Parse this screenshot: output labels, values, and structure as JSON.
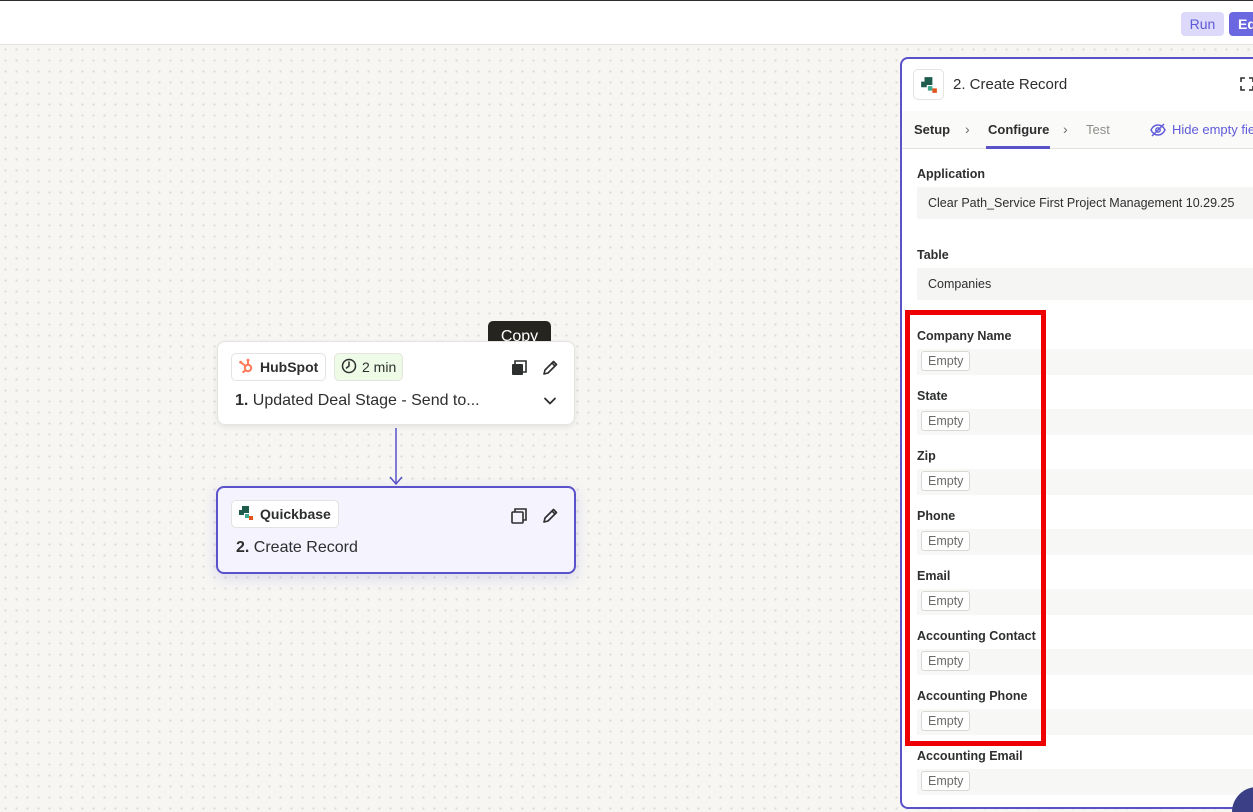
{
  "topbar": {
    "run_label": "Run",
    "edit_label": "Edit"
  },
  "tooltip": {
    "text": "Copy"
  },
  "steps": [
    {
      "app_name": "HubSpot",
      "app_icon": "hubspot-sprocket-icon",
      "duration": "2 min",
      "number": "1.",
      "title": "Updated Deal Stage - Send to...",
      "accent": "#ff7a59"
    },
    {
      "app_name": "Quickbase",
      "app_icon": "quickbase-logo-icon",
      "number": "2.",
      "title": "Create Record",
      "accent": "#5a52c9"
    }
  ],
  "panel": {
    "title": "2. Create Record",
    "tabs": {
      "setup": "Setup",
      "configure": "Configure",
      "test": "Test"
    },
    "hide_empty_label": "Hide empty fie",
    "application": {
      "label": "Application",
      "value": "Clear Path_Service First Project Management 10.29.25"
    },
    "table": {
      "label": "Table",
      "value": "Companies"
    },
    "empty_text": "Empty",
    "fields": [
      {
        "label": "Company Name"
      },
      {
        "label": "State"
      },
      {
        "label": "Zip"
      },
      {
        "label": "Phone"
      },
      {
        "label": "Email"
      },
      {
        "label": "Accounting Contact"
      },
      {
        "label": "Accounting Phone"
      },
      {
        "label": "Accounting Email"
      }
    ]
  },
  "colors": {
    "brand_purple": "#5a52c9",
    "highlight": "#ee0000",
    "time_badge_bg": "#eefbe7"
  }
}
